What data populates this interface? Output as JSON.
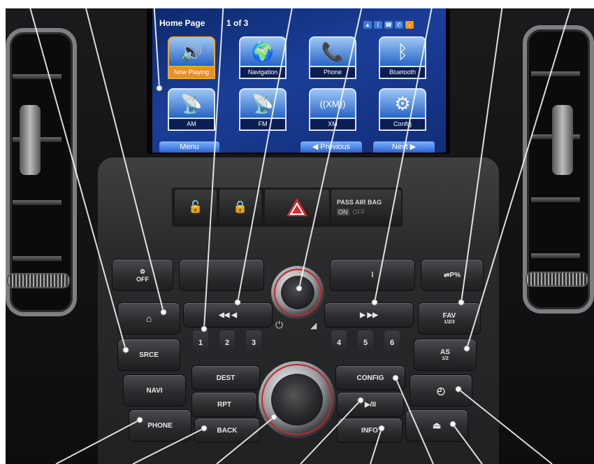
{
  "screen": {
    "page_title": "Home Page",
    "page_counter": "1 of 3",
    "status_icons": [
      "signal-icon",
      "bluetooth-status-icon",
      "phone-status-icon",
      "phone-status-icon",
      "orange-status-icon"
    ],
    "tiles": [
      {
        "label": "Now Playing",
        "icon": "speaker-icon",
        "glyph": "🔊",
        "active": true
      },
      {
        "label": "Navigation",
        "icon": "globe-icon",
        "glyph": "🌍",
        "active": false
      },
      {
        "label": "Phone",
        "icon": "phone-icon",
        "glyph": "📞",
        "active": false
      },
      {
        "label": "Bluetooth",
        "icon": "bluetooth-icon",
        "glyph": "ᛒ",
        "active": false
      },
      {
        "label": "AM",
        "icon": "antenna-icon",
        "glyph": "📡",
        "active": false
      },
      {
        "label": "FM",
        "icon": "antenna-icon",
        "glyph": "📡",
        "active": false
      },
      {
        "label": "XM",
        "icon": "xm-icon",
        "glyph": "((XM))",
        "active": false
      },
      {
        "label": "Config",
        "icon": "gears-icon",
        "glyph": "⚙",
        "active": false
      }
    ],
    "bottom_buttons": {
      "menu": "Menu",
      "previous": "Previous",
      "next": "Next"
    },
    "active_tile_color": "#e69220",
    "screen_bg_color": "#1a3e98"
  },
  "hazard_row": {
    "airbag_label": "PASS AIR BAG",
    "airbag_on": "ON",
    "airbag_off": "OFF"
  },
  "buttons": {
    "home_label": "⌂",
    "prev_track": "◀◀ ◀",
    "next_track": "▶ ▶▶",
    "srce": "SRCE",
    "navi": "NAVI",
    "phone": "PHONE",
    "dest": "DEST",
    "rpt": "RPT",
    "back": "BACK",
    "config": "CONFIG",
    "play_pause": "▶/II",
    "info": "INFO",
    "fav": "FAV",
    "fav_sub": "1/2/3",
    "as": "AS",
    "as_sub": "1/2",
    "presets": [
      "1",
      "2",
      "3",
      "4",
      "5",
      "6"
    ],
    "off_label": "OFF",
    "p_percent": "P%"
  }
}
